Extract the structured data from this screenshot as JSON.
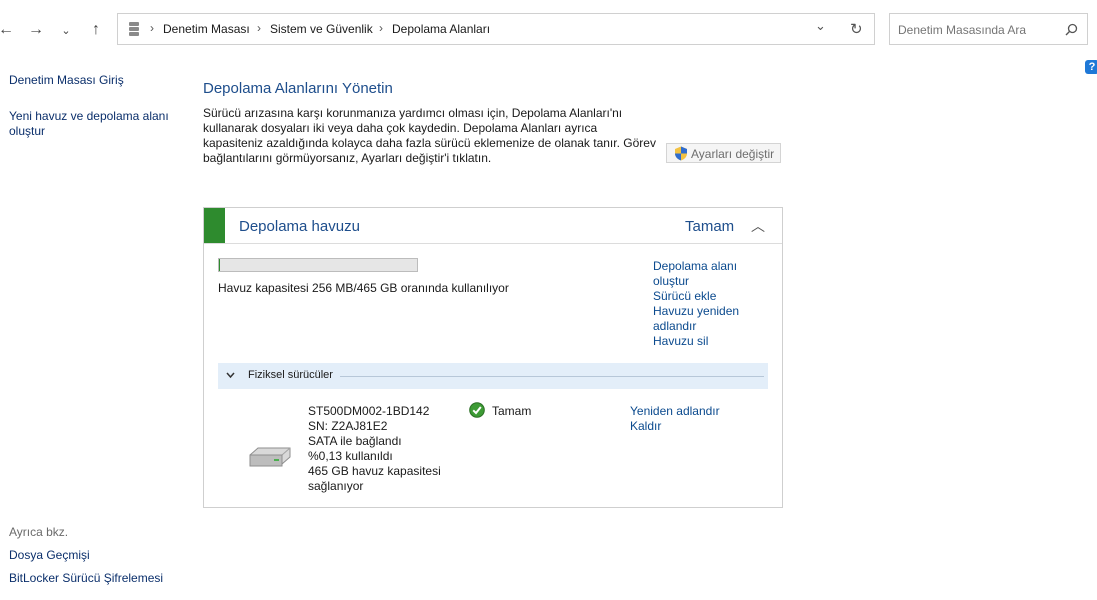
{
  "breadcrumb": {
    "items": [
      "Denetim Masası",
      "Sistem ve Güvenlik",
      "Depolama Alanları"
    ],
    "separator": "›"
  },
  "search": {
    "placeholder": "Denetim Masasında Ara"
  },
  "sidebar": {
    "home": "Denetim Masası Giriş",
    "new_pool": "Yeni havuz ve depolama alanı oluştur",
    "see_also": "Ayrıca bkz.",
    "links": [
      "Dosya Geçmişi",
      "BitLocker Sürücü Şifrelemesi"
    ]
  },
  "main": {
    "title": "Depolama Alanlarını Yönetin",
    "description": "Sürücü arızasına karşı korunmanıza yardımcı olması için, Depolama Alanları'nı kullanarak dosyaları iki veya daha çok kaydedin. Depolama Alanları ayrıca kapasiteniz azaldığında kolayca daha fazla sürücü eklemenize de olanak tanır. Görev bağlantılarını görmüyorsanız, Ayarları değiştir'i tıklatın.",
    "change_settings": "Ayarları değiştir"
  },
  "pool": {
    "name": "Depolama havuzu",
    "status": "Tamam",
    "usage_fraction": 0.0005,
    "capacity_text": "Havuz kapasitesi 256 MB/465 GB oranında kullanılıyor",
    "actions": [
      "Depolama alanı oluştur",
      "Sürücü ekle",
      "Havuzu yeniden adlandır",
      "Havuzu sil"
    ],
    "physical_header": "Fiziksel sürücüler"
  },
  "drive": {
    "model": "ST500DM002-1BD142",
    "serial": "SN: Z2AJ81E2",
    "connection": "SATA ile bağlandı",
    "used": "%0,13 kullanıldı",
    "capacity": "465 GB havuz kapasitesi sağlanıyor",
    "status": "Tamam",
    "actions": [
      "Yeniden adlandır",
      "Kaldır"
    ]
  },
  "colors": {
    "accent_green": "#2e8b2e",
    "link_blue": "#0b4a8e",
    "title_blue": "#1e4e8c"
  },
  "icons": [
    "back-icon",
    "forward-icon",
    "recent-icon",
    "up-icon",
    "storage-icon",
    "dropdown-icon",
    "refresh-icon",
    "search-icon",
    "help-icon",
    "shield-icon",
    "collapse-icon",
    "expand-icon",
    "check-icon",
    "drive-icon"
  ]
}
